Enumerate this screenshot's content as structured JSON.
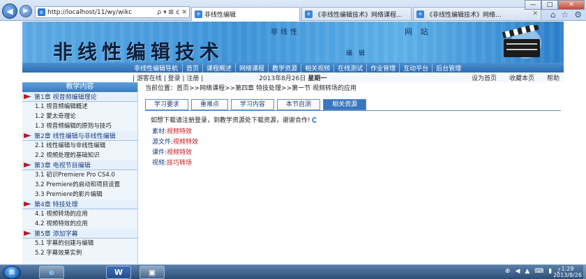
{
  "browser": {
    "address_url": "http://localhost/11/wy/wikc",
    "address_controls": "ρ ▾ ⊠ ¢ ✕",
    "tabs": [
      {
        "label": "非线性编辑"
      },
      {
        "label": "《非线性编辑技术》网络课程..."
      },
      {
        "label": "《非线性编辑技术》网络..."
      }
    ],
    "window_controls": [
      "—",
      "□",
      "✕"
    ],
    "tool_icons": [
      "home-icon",
      "star-icon",
      "gear-icon"
    ]
  },
  "banner": {
    "title": "非线性编辑技术",
    "deco_1": "非线性",
    "deco_2": "网 站",
    "deco_3": "编 辑"
  },
  "nav": {
    "head": "非线性编辑导航",
    "items": [
      "首页",
      "课程概述",
      "网络课程",
      "教学资源",
      "相关视频",
      "在线测试",
      "作业管理",
      "互动平台",
      "后台管理"
    ]
  },
  "status": {
    "links": "| 游客在线 | 登录 | 注册 |",
    "date": "2013年8月26日",
    "weekday": "星期一",
    "set_home": "设为首页",
    "bookmark": "收藏本页",
    "help": "帮助"
  },
  "sidebar": {
    "title": "教学内容",
    "chapters": [
      {
        "title": "第1章 视音频编辑理论",
        "sections": [
          "1.1 视音频编辑概述",
          "1.2 蒙太奇理论",
          "1.3 视音频编辑的原则与技巧"
        ]
      },
      {
        "title": "第2章 线性编辑与非线性编辑",
        "sections": [
          "2.1 线性编辑与非线性编辑",
          "2.2 视频处理的基础知识"
        ]
      },
      {
        "title": "第3章 电视节目编辑",
        "sections": [
          "3.1 初识Premiere Pro CS4.0",
          "3.2 Premiere的启动和项目设置",
          "3.3 Premiere的影片编辑"
        ]
      },
      {
        "title": "第4章 特技处理",
        "sections": [
          "4.1 视频转场的应用",
          "4.2 视频特效的应用"
        ]
      },
      {
        "title": "第5章 添加字幕",
        "sections": [
          "5.1 字幕的创建与编辑",
          "5.2 字幕效果实例"
        ]
      }
    ]
  },
  "main": {
    "breadcrumb": "当前位置：首页>>网络课程>>第四章 特技处理>>第一节 视频转场的应用",
    "tabs": [
      "学习要求",
      "重难点",
      "学习内容",
      "本节自测",
      "相关资源"
    ],
    "selected_tab": "相关资源",
    "notice": "如想下载请注册登录，到教学资源处下载资源，谢谢合作!",
    "resources": [
      {
        "label": "素材:",
        "value": "视频特效"
      },
      {
        "label": "源文件:",
        "value": "视频特效"
      },
      {
        "label": "课件:",
        "value": "视频特效"
      },
      {
        "label": "视频:",
        "value": "技巧转场"
      }
    ]
  },
  "taskbar": {
    "apps": [
      {
        "name": "ie-icon",
        "glyph": "e"
      },
      {
        "name": "word-icon",
        "glyph": "W"
      },
      {
        "name": "screen-icon",
        "glyph": "▣"
      }
    ],
    "tray": [
      "⊕",
      "◀",
      "▲",
      "⌨",
      "▮",
      "♪"
    ],
    "time": "1:29",
    "date": "2013/8/26"
  },
  "colors": {
    "banner_blue": "#3d93d8",
    "nav_blue": "#2c6db4",
    "link_red": "#c4161c",
    "chapter_blue": "#1c3f83"
  }
}
